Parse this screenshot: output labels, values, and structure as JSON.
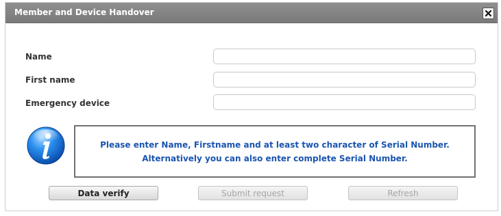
{
  "dialog": {
    "title": "Member and Device Handover"
  },
  "form": {
    "name_label": "Name",
    "name_value": "",
    "first_name_label": "First name",
    "first_name_value": "",
    "device_label": "Emergency device",
    "device_value": ""
  },
  "info": {
    "line1": "Please enter Name, Firstname and at least two character of Serial Number.",
    "line2": "Alternatively you can also enter complete Serial Number.",
    "icon": "info-icon",
    "text_color": "#1a55b0"
  },
  "buttons": {
    "verify": "Data verify",
    "submit": "Submit request",
    "refresh": "Refresh"
  },
  "colors": {
    "titlebar": "#858585",
    "title_text": "#ffffff"
  }
}
